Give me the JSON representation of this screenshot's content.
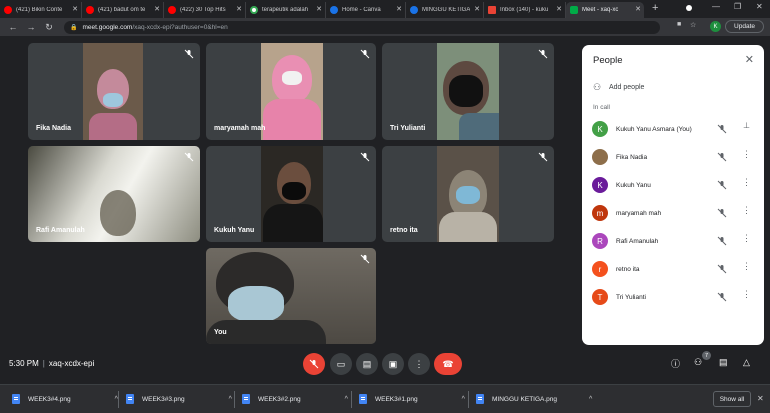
{
  "browser": {
    "tabs": [
      {
        "title": "(421) Bikin Conte",
        "favicon_color": "#ff0000",
        "active": false
      },
      {
        "title": "(421) badut om te",
        "favicon_color": "#ff0000",
        "active": false
      },
      {
        "title": "(422) 30 Top Hits",
        "favicon_color": "#ff0000",
        "active": false
      },
      {
        "title": "terapeutik adalah",
        "favicon_color": "#ffffff",
        "active": false
      },
      {
        "title": "Home - Canva",
        "favicon_color": "#1a73e8",
        "active": false
      },
      {
        "title": "MINGGU KETIGA",
        "favicon_color": "#1a73e8",
        "active": false
      },
      {
        "title": "Inbox (140) - kuku",
        "favicon_color": "#ea4335",
        "active": false
      },
      {
        "title": "Meet - xaq-xc",
        "favicon_color": "#00ac47",
        "active": true
      }
    ],
    "new_tab": "+",
    "url_host": "meet.google.com",
    "url_path": "/xaq-xcdx-epi?authuser=0&hl=en",
    "profile_initial": "K",
    "update_label": "Update"
  },
  "meeting": {
    "tiles": [
      {
        "name": "Fika Nadia"
      },
      {
        "name": "maryamah mah"
      },
      {
        "name": "Tri Yulianti"
      },
      {
        "name": "Rafi Amanulah"
      },
      {
        "name": "Kukuh Yanu"
      },
      {
        "name": "retno ita"
      },
      {
        "name": "You"
      }
    ]
  },
  "people_panel": {
    "title": "People",
    "add_people": "Add people",
    "section": "In call",
    "participants": [
      {
        "name": "Kukuh Yanu Asmara (You)",
        "initial": "K",
        "color": "#43a047"
      },
      {
        "name": "Fika Nadia",
        "initial": "",
        "color": "#8d6e4a"
      },
      {
        "name": "Kukuh Yanu",
        "initial": "K",
        "color": "#6a1b9a"
      },
      {
        "name": "maryamah mah",
        "initial": "m",
        "color": "#bf360c"
      },
      {
        "name": "Rafi Amanulah",
        "initial": "R",
        "color": "#ab47bc"
      },
      {
        "name": "retno ita",
        "initial": "r",
        "color": "#f4511e"
      },
      {
        "name": "Tri Yulianti",
        "initial": "T",
        "color": "#e64a19"
      }
    ]
  },
  "controls": {
    "time": "5:30 PM",
    "meeting_code": "xaq-xcdx-epi",
    "participant_count": "7"
  },
  "downloads": {
    "items": [
      "WEEK3#4.png",
      "WEEK3#3.png",
      "WEEK3#2.png",
      "WEEK3#1.png",
      "MINGGU KETIGA.png"
    ],
    "show_all": "Show all"
  }
}
